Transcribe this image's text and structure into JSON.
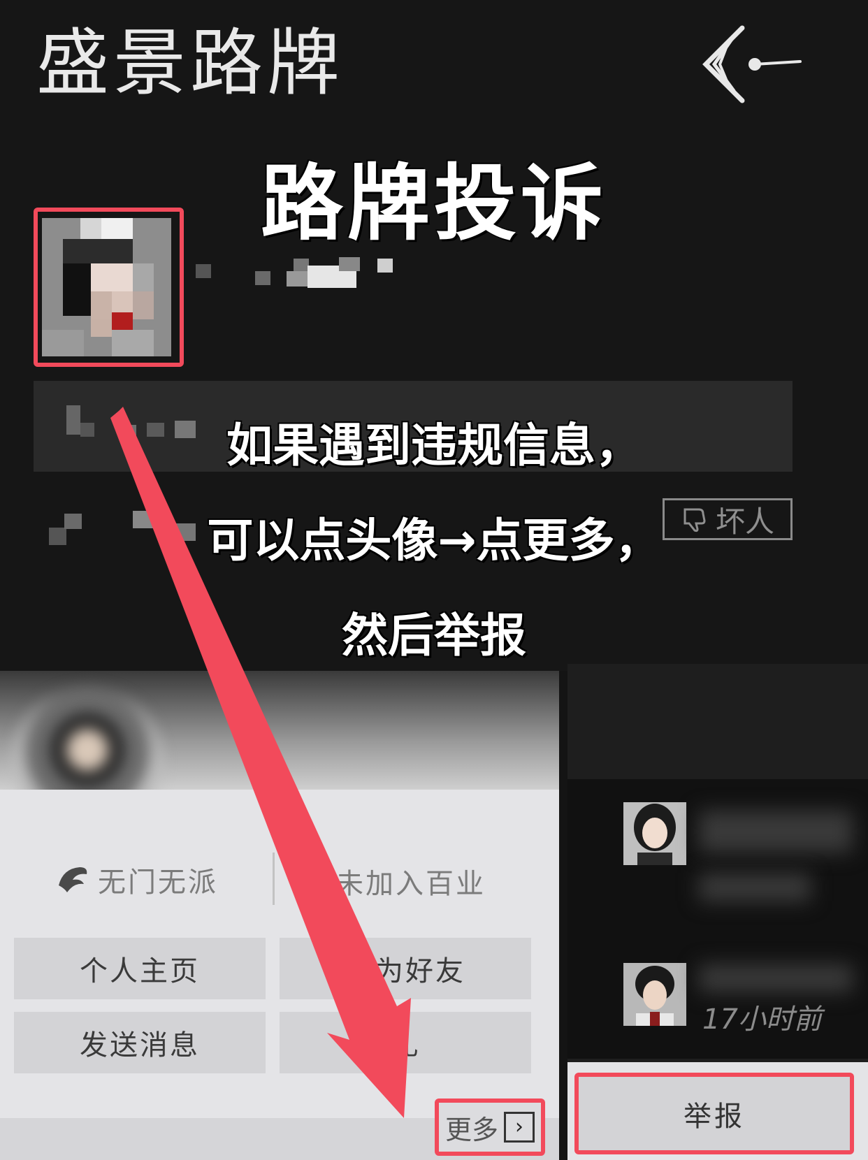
{
  "header": {
    "title": "盛景路牌",
    "back_icon": "triple-chevron-back-icon"
  },
  "headline": "路牌投诉",
  "annotation": {
    "lines": [
      "如果遇到违规信息，",
      "可以点头像→点更多，",
      "然后举报"
    ]
  },
  "post": {
    "bad_button_label": "坏人",
    "bad_button_icon": "thumbs-down-icon"
  },
  "popup": {
    "sect_label": "无门无派",
    "sect_icon": "sect-emblem-icon",
    "profession_label": "未加入百业",
    "buttons": {
      "profile": "个人主页",
      "add_friend": "加为好友",
      "send_message": "发送消息",
      "gift": "礼"
    },
    "more_label": "更多",
    "more_icon": "chevron-right-icon"
  },
  "feed": {
    "timestamp": "17小时前"
  },
  "report_label": "举报",
  "colors": {
    "highlight": "#f24a5b",
    "background": "#161616",
    "panel": "#e4e4e7"
  }
}
